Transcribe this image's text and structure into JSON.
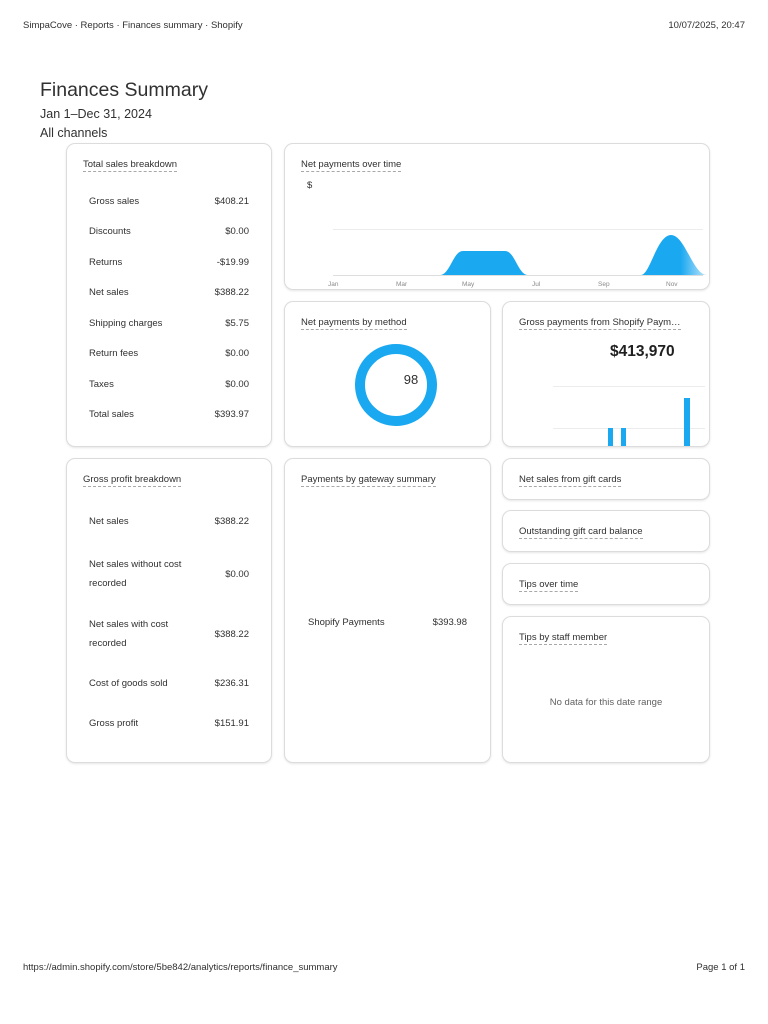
{
  "header": {
    "breadcrumb": "SimpaCove · Reports · Finances summary · Shopify",
    "datetime": "10/07/2025, 20:47"
  },
  "footer": {
    "url": "https://admin.shopify.com/store/5be842/analytics/reports/finance_summary",
    "page": "Page 1 of 1"
  },
  "page": {
    "title": "Finances Summary",
    "date_range": "Jan 1–Dec 31, 2024",
    "channel": "All channels"
  },
  "colors": {
    "accent": "#1aa8f0",
    "text": "#303030",
    "border": "#dcdcdc"
  },
  "total_sales": {
    "title": "Total sales breakdown",
    "rows": [
      {
        "label": "Gross sales",
        "value": "$408.21"
      },
      {
        "label": "Discounts",
        "value": "$0.00"
      },
      {
        "label": "Returns",
        "value": "-$19.99"
      },
      {
        "label": "Net sales",
        "value": "$388.22"
      },
      {
        "label": "Shipping charges",
        "value": "$5.75"
      },
      {
        "label": "Return fees",
        "value": "$0.00"
      },
      {
        "label": "Taxes",
        "value": "$0.00"
      },
      {
        "label": "Total sales",
        "value": "$393.97"
      }
    ]
  },
  "net_payments_time": {
    "title": "Net payments over time",
    "axis_unit": "$",
    "x_ticks": [
      "Jan",
      "Mar",
      "May",
      "Jul",
      "Sep",
      "Nov"
    ]
  },
  "net_payments_method": {
    "title": "Net payments by method",
    "center_value": "98"
  },
  "gross_payments_shopify": {
    "title": "Gross payments from Shopify Paym…",
    "value": "$413,970"
  },
  "gross_profit": {
    "title": "Gross profit breakdown",
    "rows": [
      {
        "label": "Net sales",
        "value": "$388.22"
      },
      {
        "label": "Net sales without cost recorded",
        "value": "$0.00"
      },
      {
        "label": "Net sales with cost recorded",
        "value": "$388.22"
      },
      {
        "label": "Cost of goods sold",
        "value": "$236.31"
      },
      {
        "label": "Gross profit",
        "value": "$151.91"
      }
    ]
  },
  "gateway": {
    "title": "Payments by gateway summary",
    "row": {
      "label": "Shopify Payments",
      "value": "$393.98"
    }
  },
  "gift_cards": {
    "title": "Net sales from gift cards"
  },
  "outstanding_gift": {
    "title": "Outstanding gift card balance"
  },
  "tips_time": {
    "title": "Tips over time"
  },
  "tips_staff": {
    "title": "Tips by staff member",
    "empty": "No data for this date range"
  }
}
